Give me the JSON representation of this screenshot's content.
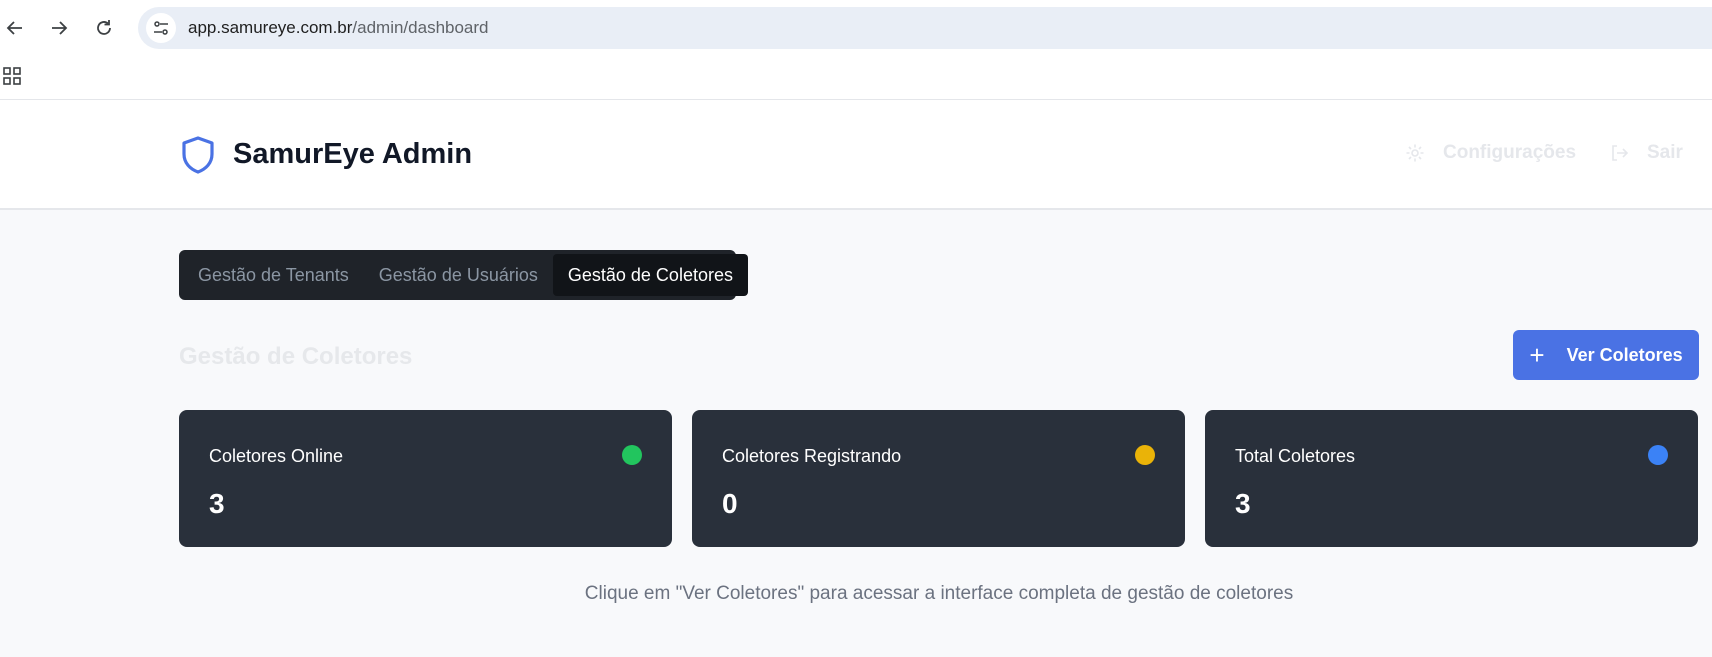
{
  "browser": {
    "url_host": "app.samureye.com.br",
    "url_path": "/admin/dashboard"
  },
  "header": {
    "title": "SamurEye Admin",
    "settings_label": "Configurações",
    "logout_label": "Sair"
  },
  "tabs": [
    {
      "label": "Gestão de Tenants",
      "active": false
    },
    {
      "label": "Gestão de Usuários",
      "active": false
    },
    {
      "label": "Gestão de Coletores",
      "active": true
    }
  ],
  "section": {
    "title": "Gestão de Coletores",
    "action_label": "Ver Coletores",
    "action_icon": "plus-icon"
  },
  "cards": [
    {
      "label": "Coletores Online",
      "value": "3",
      "dot_color": "#22c55e"
    },
    {
      "label": "Coletores Registrando",
      "value": "0",
      "dot_color": "#eab308"
    },
    {
      "label": "Total Coletores",
      "value": "3",
      "dot_color": "#3b82f6"
    }
  ],
  "hint": "Clique em \"Ver Coletores\" para acessar a interface completa de gestão de coletores",
  "colors": {
    "accent": "#4a72e4",
    "card_bg": "#29303b",
    "tabs_bg": "#1f2329"
  }
}
